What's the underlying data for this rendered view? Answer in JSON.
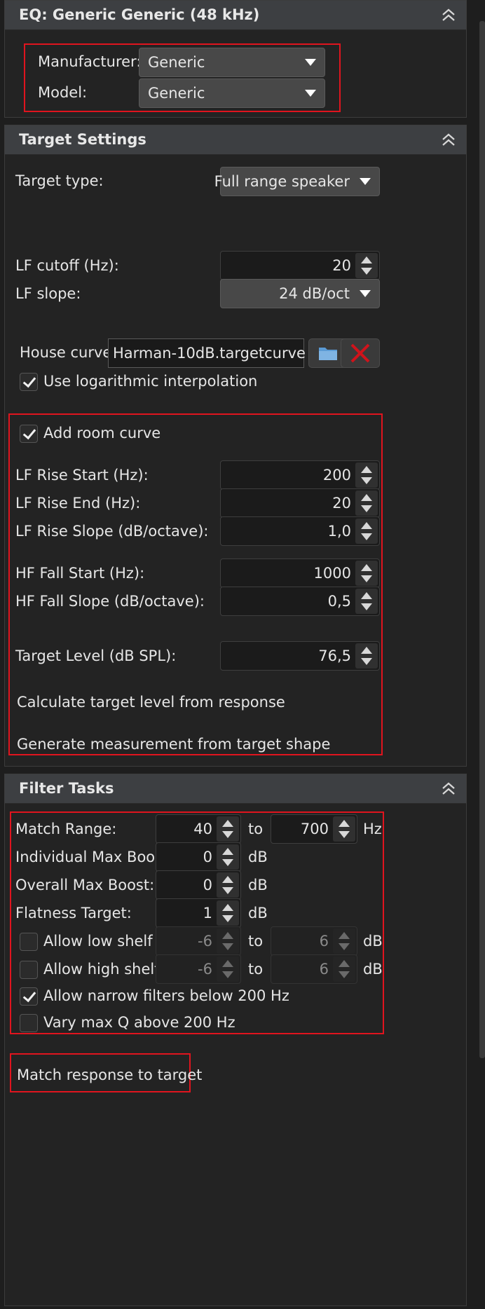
{
  "eq_panel": {
    "title": "EQ: Generic Generic (48 kHz)",
    "manufacturer_label": "Manufacturer:",
    "manufacturer_value": "Generic",
    "model_label": "Model:",
    "model_value": "Generic"
  },
  "target_panel": {
    "title": "Target Settings",
    "target_type_label": "Target type:",
    "target_type_value": "Full range speaker",
    "lf_cutoff_label": "LF cutoff (Hz):",
    "lf_cutoff_value": "20",
    "lf_slope_label": "LF slope:",
    "lf_slope_value": "24 dB/oct",
    "house_curve_label": "House curve:",
    "house_curve_value": "Harman-10dB.targetcurve",
    "log_interp_label": "Use logarithmic interpolation",
    "log_interp_checked": true,
    "room_curve": {
      "add_label": "Add room curve",
      "add_checked": true,
      "lf_rise_start_label": "LF Rise Start (Hz):",
      "lf_rise_start_value": "200",
      "lf_rise_end_label": "LF Rise End (Hz):",
      "lf_rise_end_value": "20",
      "lf_rise_slope_label": "LF Rise Slope (dB/octave):",
      "lf_rise_slope_value": "1,0",
      "hf_fall_start_label": "HF Fall Start (Hz):",
      "hf_fall_start_value": "1000",
      "hf_fall_slope_label": "HF Fall Slope (dB/octave):",
      "hf_fall_slope_value": "0,5"
    },
    "target_level_label": "Target Level (dB SPL):",
    "target_level_value": "76,5",
    "calc_target_label": "Calculate target level from response",
    "generate_label": "Generate measurement from target shape"
  },
  "filter_panel": {
    "title": "Filter Tasks",
    "match_range_label": "Match Range:",
    "match_range_from": "40",
    "to_label": "to",
    "match_range_to": "700",
    "hz_unit": "Hz",
    "db_unit": "dB",
    "indiv_max_boost_label": "Individual Max Boost:",
    "indiv_max_boost_value": "0",
    "overall_max_boost_label": "Overall Max Boost:",
    "overall_max_boost_value": "0",
    "flatness_label": "Flatness Target:",
    "flatness_value": "1",
    "low_shelf_label": "Allow low shelf",
    "low_shelf_checked": false,
    "low_shelf_min": "-6",
    "low_shelf_max": "6",
    "high_shelf_label": "Allow high shelf",
    "high_shelf_checked": false,
    "high_shelf_min": "-6",
    "high_shelf_max": "6",
    "narrow_label": "Allow narrow filters below 200 Hz",
    "narrow_checked": true,
    "vary_q_label": "Vary max Q above 200 Hz",
    "vary_q_checked": false,
    "match_button_label": "Match response to target"
  },
  "colors": {
    "background": "#1e1e1e",
    "panel_header": "#3d3f42",
    "highlight_red": "#e0141e",
    "delete_red": "#d0131b",
    "folder_blue": "#5b9bd5"
  },
  "icons": {
    "collapse": "double-chevron-up-icon",
    "folder": "folder-icon",
    "delete": "x-icon",
    "dropdown": "triangle-down-icon"
  }
}
